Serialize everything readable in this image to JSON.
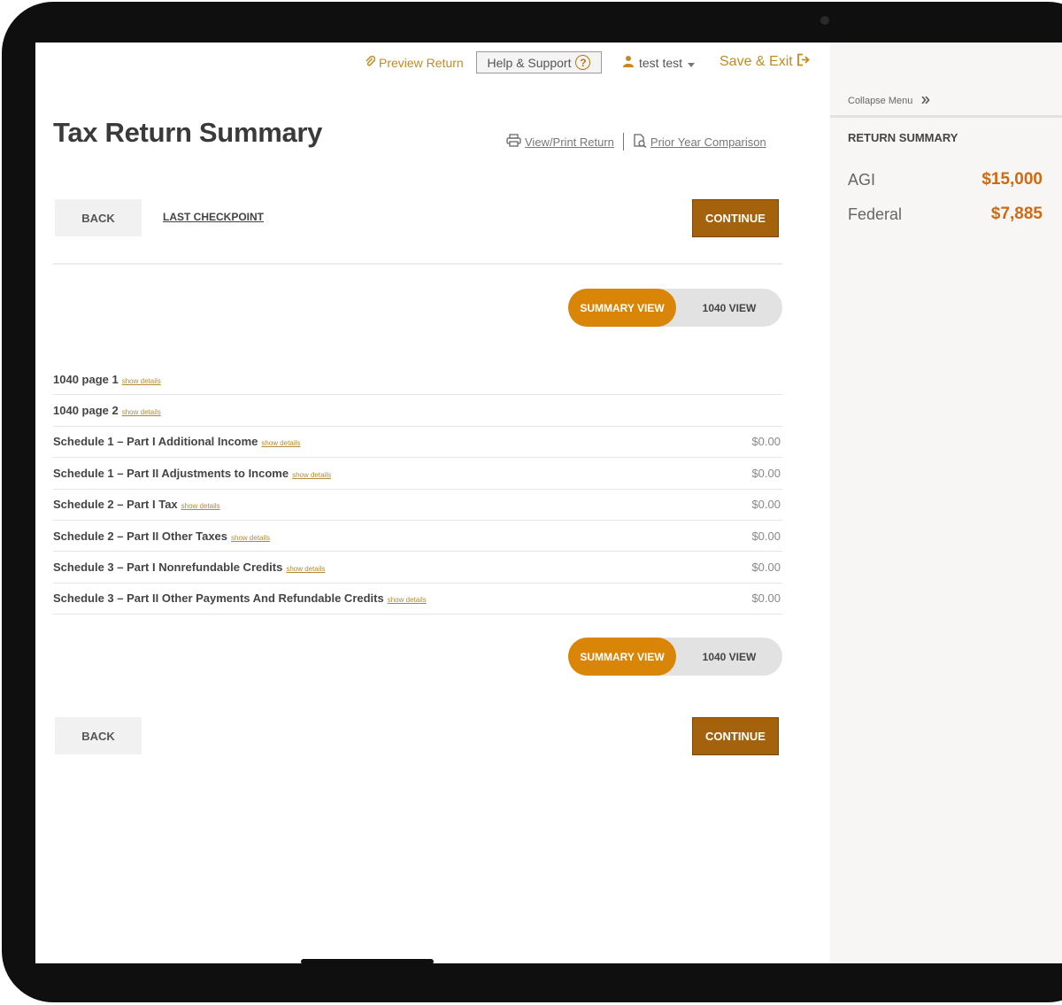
{
  "topnav": {
    "preview_label": "Preview Return",
    "help_label": "Help & Support",
    "user_label": "test test",
    "save_label": "Save & Exit"
  },
  "page": {
    "title": "Tax Return Summary",
    "view_print_label": "View/Print Return",
    "prior_year_label": "Prior Year Comparison"
  },
  "nav_buttons": {
    "back_label": "BACK",
    "checkpoint_label": "LAST CHECKPOINT",
    "continue_label": "CONTINUE"
  },
  "view_toggle": {
    "summary_label": "SUMMARY VIEW",
    "form_label": "1040 VIEW",
    "active": "SUMMARY VIEW"
  },
  "summary_rows": [
    {
      "label": "1040 page 1",
      "details": "show details",
      "amount": ""
    },
    {
      "label": "1040 page 2",
      "details": "show details",
      "amount": ""
    },
    {
      "label": "Schedule 1 – Part I Additional Income",
      "details": "show details",
      "amount": "$0.00"
    },
    {
      "label": "Schedule 1 – Part II Adjustments to Income",
      "details": "show details",
      "amount": "$0.00"
    },
    {
      "label": "Schedule 2 – Part I Tax",
      "details": "show details",
      "amount": "$0.00"
    },
    {
      "label": "Schedule 2 – Part II Other Taxes",
      "details": "show details",
      "amount": "$0.00"
    },
    {
      "label": "Schedule 3 – Part I Nonrefundable Credits",
      "details": "show details",
      "amount": "$0.00"
    },
    {
      "label": "Schedule 3 – Part II Other Payments And Refundable Credits",
      "details": "show details",
      "amount": "$0.00"
    }
  ],
  "sidebar": {
    "collapse_label": "Collapse Menu",
    "heading": "RETURN SUMMARY",
    "metrics": [
      {
        "label": "AGI",
        "value": "$15,000"
      },
      {
        "label": "Federal",
        "value": "$7,885"
      }
    ]
  },
  "colors": {
    "accent": "#d98608",
    "continue_button": "#a5620d",
    "link": "#c68a1e",
    "metric_value": "#cf6a12"
  }
}
